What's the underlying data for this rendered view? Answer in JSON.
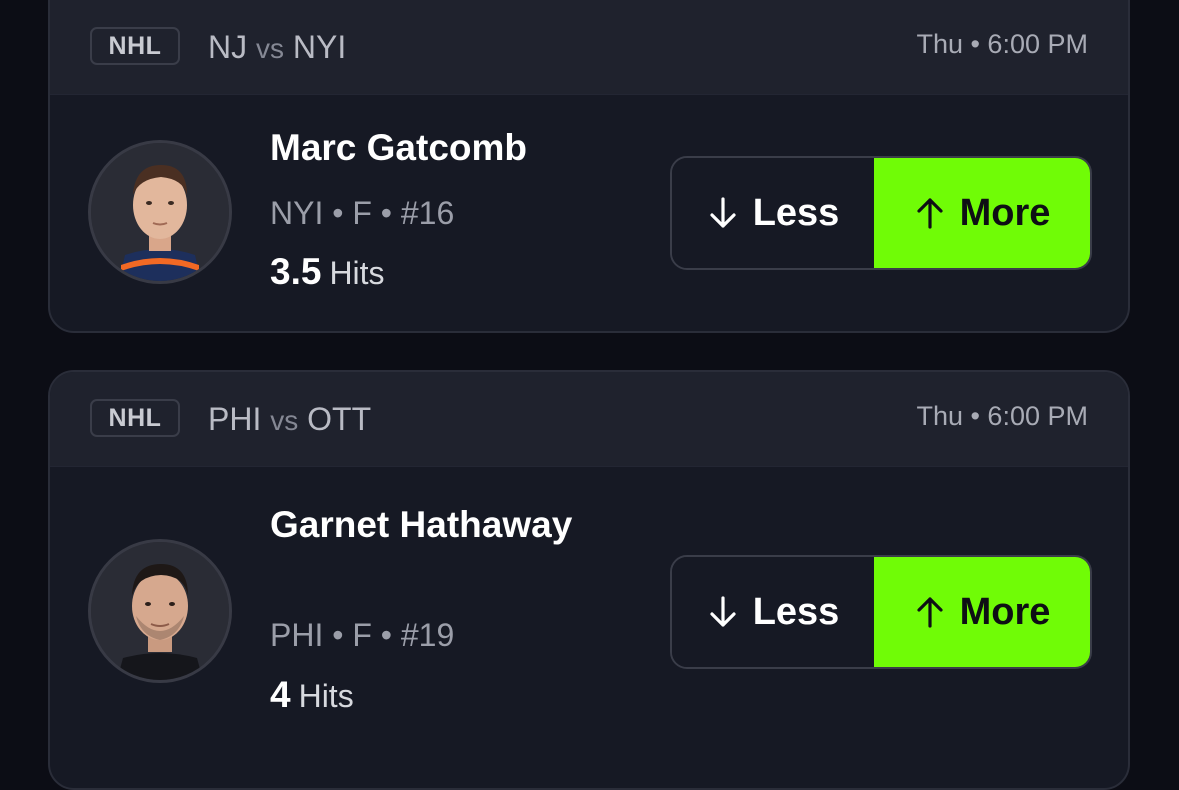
{
  "cards": [
    {
      "league": "NHL",
      "team_a": "NJ",
      "vs": "vs",
      "team_b": "NYI",
      "time": "Thu • 6:00 PM",
      "player_name": "Marc Gatcomb",
      "player_meta": "NYI • F • #16",
      "line_value": "3.5",
      "stat": "Hits",
      "less_label": "Less",
      "more_label": "More",
      "less_icon": "arrow-down-icon",
      "more_icon": "arrow-up-icon"
    },
    {
      "league": "NHL",
      "team_a": "PHI",
      "vs": "vs",
      "team_b": "OTT",
      "time": "Thu • 6:00 PM",
      "player_name": "Garnet Hathaway",
      "player_meta": "PHI • F • #19",
      "line_value": "4",
      "stat": "Hits",
      "less_label": "Less",
      "more_label": "More",
      "less_icon": "arrow-down-icon",
      "more_icon": "arrow-up-icon"
    }
  ],
  "colors": {
    "background": "#0c0d15",
    "card": "#161924",
    "card_header": "#1f222d",
    "more_accent": "#70fc06"
  }
}
